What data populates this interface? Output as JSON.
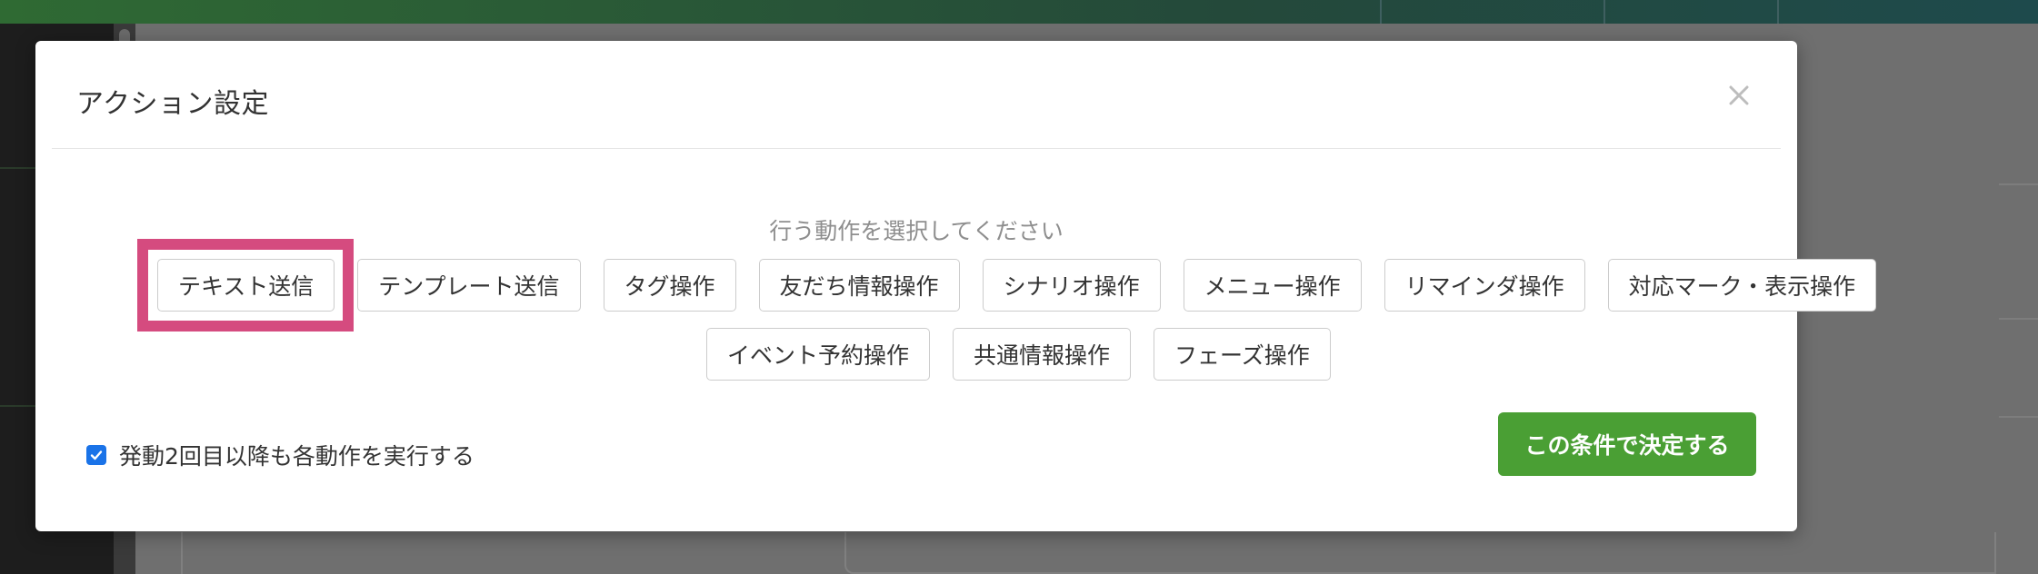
{
  "modal": {
    "title": "アクション設定",
    "close_icon": "close-icon",
    "instruction": "行う動作を選択してください",
    "actions_row1": [
      "テキスト送信",
      "テンプレート送信",
      "タグ操作",
      "友だち情報操作",
      "シナリオ操作",
      "メニュー操作",
      "リマインダ操作",
      "対応マーク・表示操作"
    ],
    "actions_row2": [
      "イベント予約操作",
      "共通情報操作",
      "フェーズ操作"
    ],
    "highlighted_action": "テキスト送信",
    "checkbox": {
      "label": "発動2回目以降も各動作を実行する",
      "checked": true
    },
    "submit_label": "この条件で決定する"
  },
  "colors": {
    "highlight": "#d54b7f",
    "submit": "#4a9f34",
    "checkbox": "#1a73e8"
  }
}
